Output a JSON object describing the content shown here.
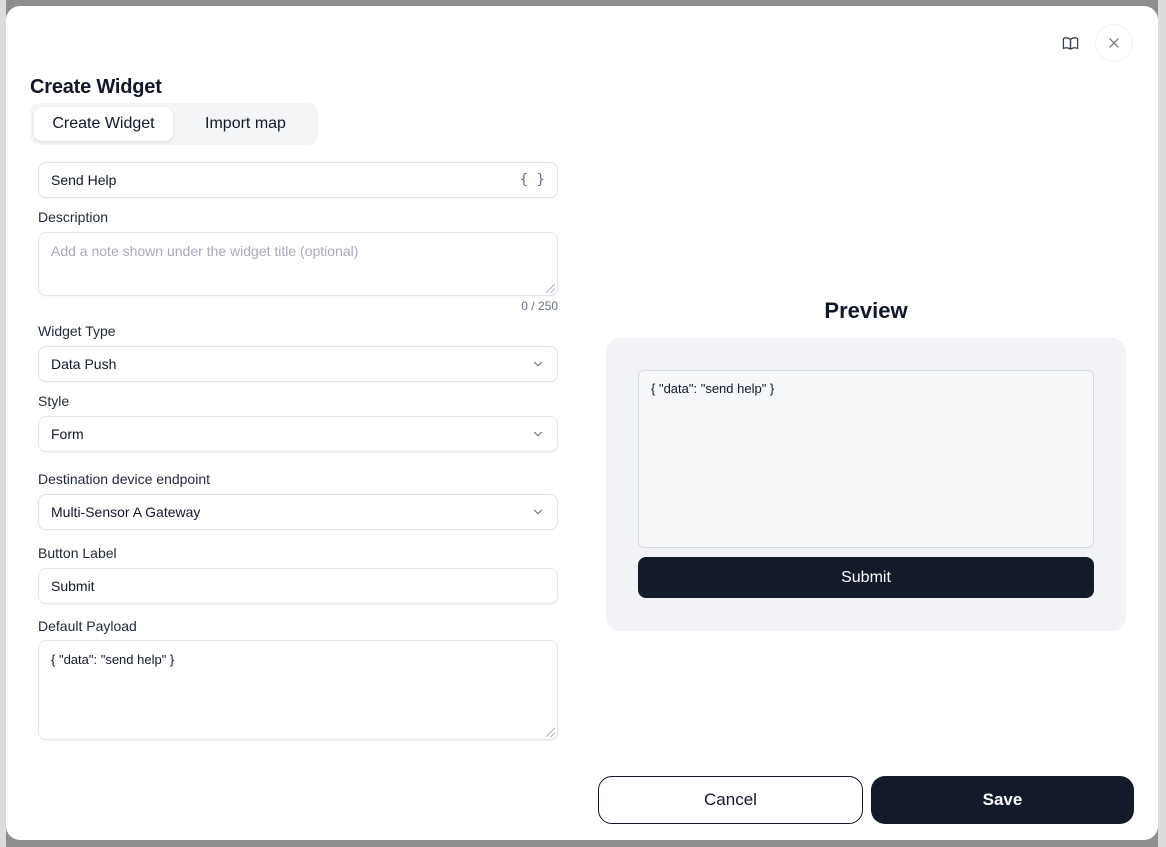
{
  "window": {
    "title": "Create Widget"
  },
  "tabs": [
    {
      "label": "Create Widget",
      "active": true
    },
    {
      "label": "Import map",
      "active": false
    }
  ],
  "form": {
    "name": {
      "value": "Send Help",
      "brace_icon": "{ }"
    },
    "description": {
      "label": "Description",
      "placeholder": "Add a note shown under the widget title (optional)",
      "value": "",
      "counter": "0 / 250"
    },
    "widget_type": {
      "label": "Widget Type",
      "value": "Data Push"
    },
    "style": {
      "label": "Style",
      "value": "Form"
    },
    "destination": {
      "label": "Destination device endpoint",
      "value": "Multi-Sensor A Gateway"
    },
    "button_label": {
      "label": "Button Label",
      "value": "Submit"
    },
    "default_payload": {
      "label": "Default Payload",
      "value": "{ \"data\": \"send help\" }"
    }
  },
  "preview": {
    "title": "Preview",
    "payload": "{ \"data\": \"send help\" }",
    "submit_label": "Submit"
  },
  "footer": {
    "cancel_label": "Cancel",
    "save_label": "Save"
  },
  "icons": {
    "docs": "book-icon",
    "close": "close-icon",
    "dropdown": "chevron-down-icon"
  },
  "colors": {
    "primary": "#131a29",
    "panel": "#f2f3f6",
    "border": "#e2e3ea"
  }
}
